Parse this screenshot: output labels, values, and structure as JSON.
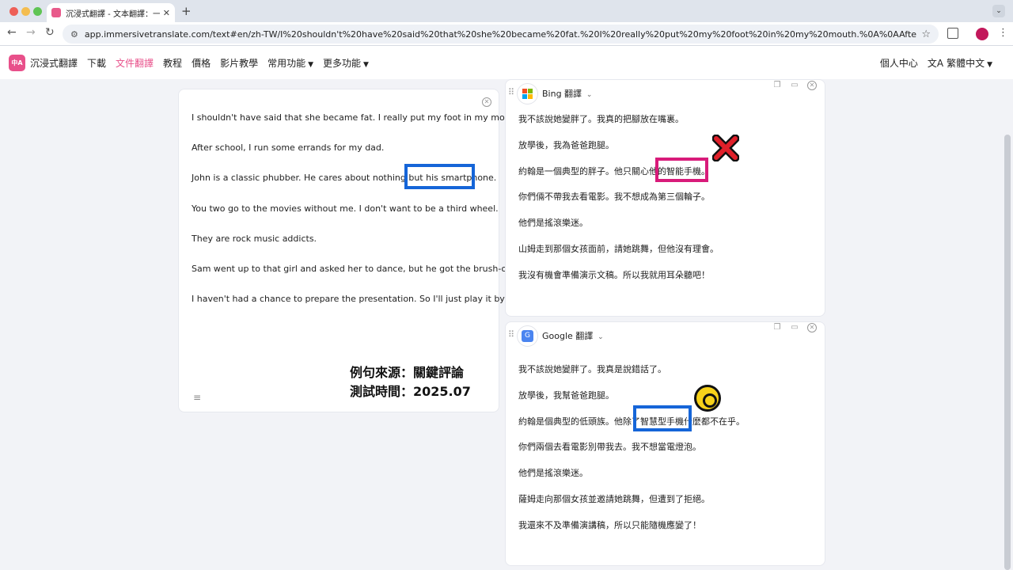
{
  "browser": {
    "tab_title": "沉浸式翻譯 - 文本翻譯：一鍵翻...",
    "url": "app.immersivetranslate.com/text#en/zh-TW/I%20shouldn't%20have%20said%20that%20she%20became%20fat.%20I%20really%20put%20my%20foot%20in%20my%20mouth.%0A%0AAfter%20school%2C%20I%20run%20som..."
  },
  "nav": {
    "logo_text": "中A",
    "brand": "沉浸式翻譯",
    "items": [
      "下載",
      "文件翻譯",
      "教程",
      "價格",
      "影片教學",
      "常用功能",
      "更多功能"
    ],
    "right_user": "個人中心",
    "right_lang": "繁體中文"
  },
  "source": {
    "lines": [
      "I shouldn't have said that she became fat. I really put my foot in my mouth.",
      "After school, I run some errands for my dad.",
      "John is a classic phubber. He cares about nothing but his smartphone.",
      "You two go to the movies without me. I don't want to be a third wheel.",
      "They are rock music addicts.",
      "Sam went up to that girl and asked her to dance, but he got the brush-off.",
      "I haven't had a chance to prepare the presentation. So I'll just play it by ear!"
    ],
    "note_source": "例句來源：關鍵評論",
    "note_date": "測試時間：2025.07"
  },
  "bing": {
    "name": "Bing 翻譯",
    "lines": [
      "我不該說她變胖了。我真的把腳放在嘴裏。",
      "放學後，我為爸爸跑腿。",
      "約翰是一個典型的胖子。他只關心他的智能手機。",
      "你們倆不帶我去看電影。我不想成為第三個輪子。",
      "他們是搖滾樂迷。",
      "山姆走到那個女孩面前，請她跳舞，但他沒有理會。",
      "我沒有機會準備演示文稿。所以我就用耳朵聽吧！"
    ]
  },
  "google": {
    "name": "Google 翻譯",
    "lines": [
      "我不該說她變胖了。我真是說錯話了。",
      "放學後，我幫爸爸跑腿。",
      "約翰是個典型的低頭族。他除了智慧型手機什麼都不在乎。",
      "你們兩個去看電影別帶我去。我不想當電燈泡。",
      "他們是搖滾樂迷。",
      "薩姆走向那個女孩並邀請她跳舞，但遭到了拒絕。",
      "我還來不及準備演講稿，所以只能隨機應變了！"
    ]
  },
  "colors": {
    "accent": "#e8508a",
    "highlight_blue": "#1565d8",
    "highlight_pink": "#d81b7a",
    "cross_red": "#e0202a",
    "target_yellow": "#f7d21a"
  }
}
